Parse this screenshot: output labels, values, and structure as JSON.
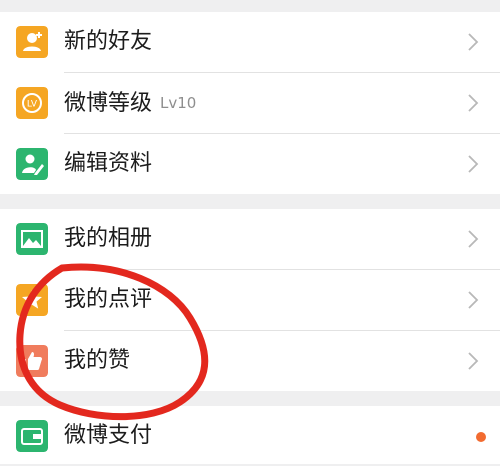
{
  "colors": {
    "orange": "#f5a623",
    "green": "#2cb56f",
    "salmon": "#f07c5d",
    "annotation": "#e3281e",
    "badge": "#f26b30"
  },
  "menu": {
    "group1": [
      {
        "label": "新的好友",
        "icon": "person-add-icon"
      },
      {
        "label": "微博等级",
        "level": "Lv10",
        "icon": "level-badge-icon"
      },
      {
        "label": "编辑资料",
        "icon": "edit-profile-icon"
      }
    ],
    "group2": [
      {
        "label": "我的相册",
        "icon": "photo-album-icon"
      },
      {
        "label": "我的点评",
        "icon": "star-review-icon"
      },
      {
        "label": "我的赞",
        "icon": "thumbs-up-icon"
      }
    ],
    "group3": [
      {
        "label": "微博支付",
        "icon": "wallet-icon"
      }
    ]
  }
}
